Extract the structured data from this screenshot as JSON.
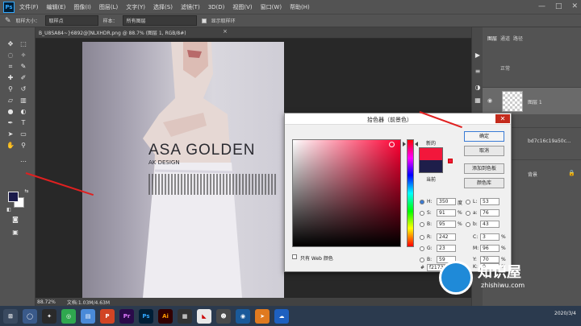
{
  "app": {
    "logo": "Ps"
  },
  "menubar": {
    "items": [
      "文件(F)",
      "编辑(E)",
      "图像(I)",
      "图层(L)",
      "文字(Y)",
      "选择(S)",
      "滤镜(T)",
      "3D(D)",
      "视图(V)",
      "窗口(W)",
      "帮助(H)"
    ]
  },
  "optionsbar": {
    "sample_size_label": "取样大小：",
    "sample_size_value": "取样点",
    "sample_label": "样本：",
    "sample_value": "所有图层",
    "show_ring_label": "显示取样环"
  },
  "document": {
    "tab_title": "B_U8SA84~}6892@]NLXHDR.png @ 88.7% (图层 1, RGB/8#)",
    "photo_text_1": "ASA GOLDEN",
    "photo_text_2": "AK DESIGN"
  },
  "statusbar": {
    "zoom": "88.72%",
    "doc_info": "文档:1.03M/4.63M"
  },
  "panels": {
    "tabs": [
      "图层",
      "通道",
      "路径"
    ],
    "blend_mode": "正常",
    "layers": [
      {
        "name": "图层 1"
      },
      {
        "name": "bd7c16c19a50c..."
      },
      {
        "name": "背景"
      }
    ]
  },
  "picker": {
    "title": "拾色器（前景色）",
    "new_label": "新的",
    "current_label": "当前",
    "buttons": {
      "ok": "确定",
      "cancel": "取消",
      "add_swatch": "添加到色板",
      "libraries": "颜色库"
    },
    "fields": {
      "H": "350",
      "H_unit": "度",
      "S": "91",
      "B": "95",
      "pct": "%",
      "R": "242",
      "G": "23",
      "Bl": "59",
      "L": "53",
      "a": "76",
      "b": "43",
      "C": "3",
      "M": "96",
      "Y": "70",
      "K": "0",
      "hex_label": "#",
      "hex": "f2173b"
    },
    "web_only_label": "只有 Web 颜色",
    "new_color": "#f2173b",
    "current_color": "#1e1e4a"
  },
  "watermark": {
    "name": "知识屋",
    "url": "zhishiwu.com"
  },
  "taskbar": {
    "clock_time": "",
    "clock_date": "2020/3/4"
  }
}
